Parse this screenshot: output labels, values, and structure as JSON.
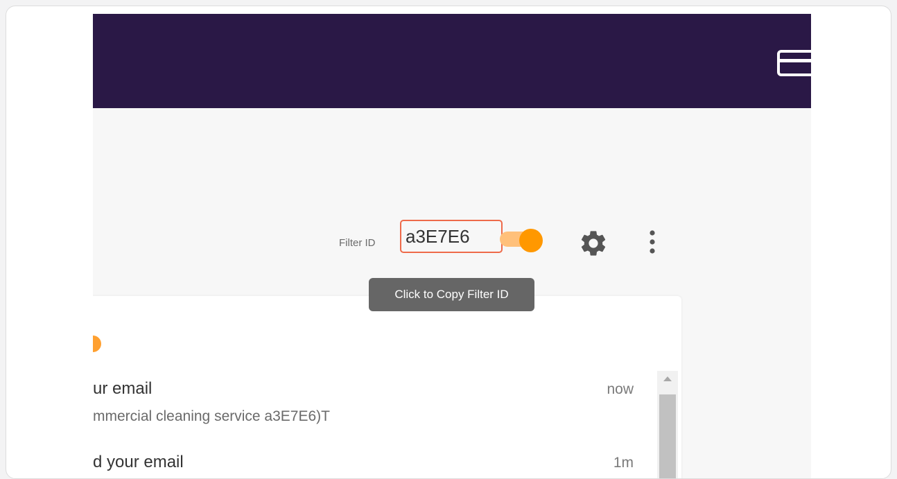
{
  "header": {
    "card_icon": "credit-card-icon",
    "bg_color": "#2a1846"
  },
  "toolbar": {
    "filter_label": "Filter ID",
    "filter_id_value": "a3E7E6",
    "toggle_on": true,
    "accent_color": "#ff9800",
    "highlight_color": "#ee6a4a",
    "settings_icon": "gear-icon",
    "more_icon": "more-vertical-icon"
  },
  "tooltip": {
    "text": "Click to Copy Filter ID"
  },
  "list": {
    "rows": [
      {
        "title": "ur email",
        "subtitle": "mmercial cleaning service a3E7E6)T",
        "time": "now"
      },
      {
        "title": "d your email",
        "subtitle": "",
        "time": "1m"
      }
    ]
  }
}
